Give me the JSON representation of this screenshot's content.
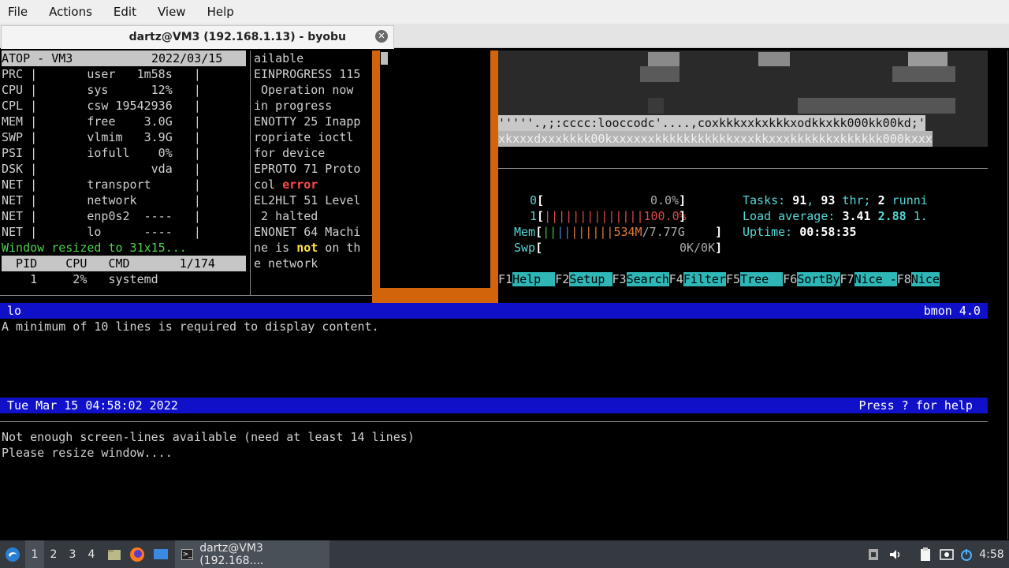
{
  "menubar": {
    "items": [
      "File",
      "Actions",
      "Edit",
      "View",
      "Help"
    ]
  },
  "tab": {
    "title": "dartz@VM3 (192.168.1.13) - byobu",
    "close_icon": "close-icon"
  },
  "atop": {
    "header_left": "ATOP - VM3",
    "header_right": "2022/03/15",
    "rows": [
      "PRC |       user   1m58s   |",
      "CPU |       sys      12%   |",
      "CPL |       csw 19542936   |",
      "MEM |       free    3.0G   |",
      "SWP |       vlmim   3.9G   |",
      "PSI |       iofull    0%   |",
      "DSK |                vda   |",
      "NET |       transport      |",
      "NET |       network        |",
      "NET |       enp0s2  ----   |",
      "NET |       lo      ----   |"
    ],
    "resize_msg": "Window resized to 31x15...",
    "proc_header": "  PID    CPU   CMD       1/174",
    "proc_row": "    1     2%   systemd"
  },
  "errno": {
    "lines": [
      "ailable",
      "EINPROGRESS 115",
      " Operation now",
      "in progress",
      "ENOTTY 25 Inapp",
      "ropriate ioctl",
      "for device",
      "EPROTO 71 Proto",
      "col ",
      "EL2HLT 51 Level",
      " 2 halted",
      "ENONET 64 Machi",
      "ne is ",
      "e network"
    ],
    "error_word": "error",
    "not_word": "not",
    "on_th": " on th"
  },
  "art": {
    "row1": "'''''.,;:cccc:looccodc'....,coxkkkxxkxkkkxodkkxkk000kk00kd;'",
    "row2": "xkxxxdxxxkkkk00kxxxxxxkkkkkkkkkkkxxxkkxxxkkkkkkxkkkkkk000kxxx"
  },
  "htop": {
    "cpu0_label": "0",
    "cpu0_val": "0.0%",
    "cpu1_label": "1",
    "cpu1_val": "100.0%",
    "mem_label": "Mem",
    "mem_val": "534M",
    "mem_total": "/7.77G",
    "swp_label": "Swp",
    "swp_val": "0K/0K",
    "tasks_label": "Tasks: ",
    "tasks_n": "91",
    "tasks_sep": ", ",
    "thr_n": "93",
    "thr_label": " thr; ",
    "running_n": "2",
    "running_label": " runni",
    "load_label": "Load average: ",
    "load1": "3.41",
    "load5": "2.88",
    "load15": "1.",
    "uptime_label": "Uptime: ",
    "uptime": "00:58:35",
    "fkeys": [
      {
        "key": "F1",
        "label": "Help  "
      },
      {
        "key": "F2",
        "label": "Setup "
      },
      {
        "key": "F3",
        "label": "Search"
      },
      {
        "key": "F4",
        "label": "Filter"
      },
      {
        "key": "F5",
        "label": "Tree  "
      },
      {
        "key": "F6",
        "label": "SortBy"
      },
      {
        "key": "F7",
        "label": "Nice -"
      },
      {
        "key": "F8",
        "label": "Nice"
      }
    ]
  },
  "bmon": {
    "interface": " lo",
    "version": "bmon 4.0 ",
    "message": "A minimum of 10 lines is required to display content.",
    "datetime": " Tue Mar 15 04:58:02 2022",
    "help_hint": "Press ? for help "
  },
  "bottom": {
    "line1": "Not enough screen-lines available (need at least 14 lines)",
    "line2": "Please resize window...."
  },
  "panel": {
    "workspaces": [
      "1",
      "2",
      "3",
      "4"
    ],
    "task_label": "dartz@VM3 (192.168....",
    "clock": "4:58"
  }
}
